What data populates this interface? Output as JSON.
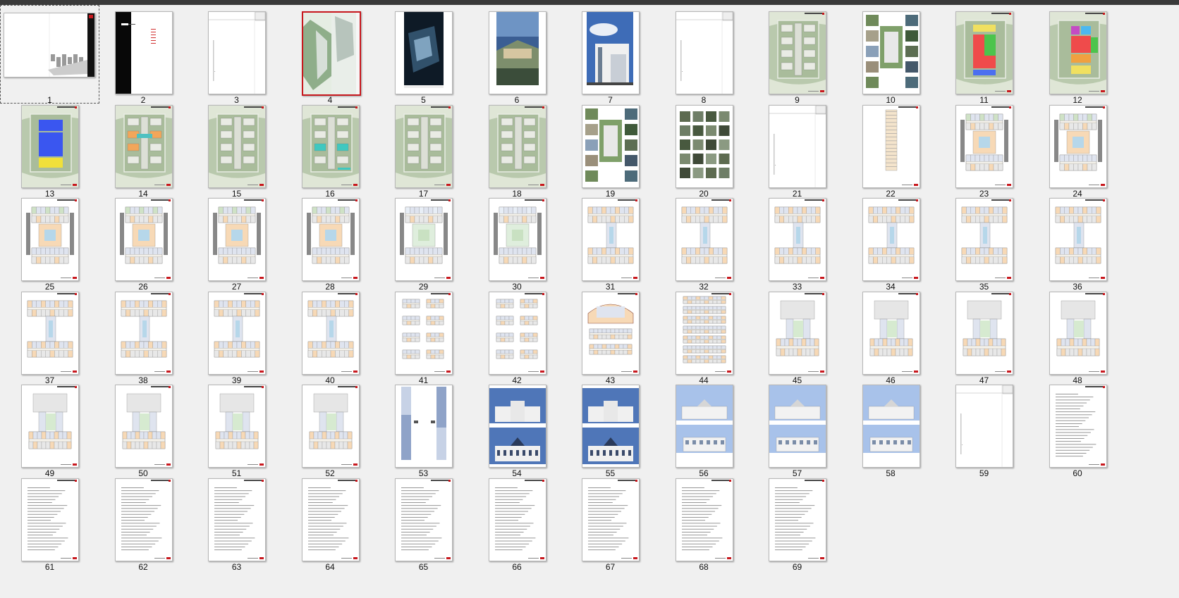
{
  "viewer": {
    "selected_page": "1",
    "highlighted_page": "4"
  },
  "pages": [
    {
      "label": "1",
      "kind": "cover"
    },
    {
      "label": "2",
      "kind": "black-index"
    },
    {
      "label": "3",
      "kind": "divider"
    },
    {
      "label": "4",
      "kind": "aerial-strip"
    },
    {
      "label": "5",
      "kind": "dark-render"
    },
    {
      "label": "6",
      "kind": "blue-render"
    },
    {
      "label": "7",
      "kind": "sky-render"
    },
    {
      "label": "8",
      "kind": "divider"
    },
    {
      "label": "9",
      "kind": "site-plan"
    },
    {
      "label": "10",
      "kind": "photo-collage"
    },
    {
      "label": "11",
      "kind": "zoning-red"
    },
    {
      "label": "12",
      "kind": "zoning-color"
    },
    {
      "label": "13",
      "kind": "zoning-blue"
    },
    {
      "label": "14",
      "kind": "site-orange"
    },
    {
      "label": "15",
      "kind": "site-plan"
    },
    {
      "label": "16",
      "kind": "site-teal"
    },
    {
      "label": "17",
      "kind": "site-plan"
    },
    {
      "label": "18",
      "kind": "site-plan"
    },
    {
      "label": "19",
      "kind": "photo-collage"
    },
    {
      "label": "20",
      "kind": "photo-grid"
    },
    {
      "label": "21",
      "kind": "divider"
    },
    {
      "label": "22",
      "kind": "long-plan"
    },
    {
      "label": "23",
      "kind": "floor-plan"
    },
    {
      "label": "24",
      "kind": "floor-plan"
    },
    {
      "label": "25",
      "kind": "floor-plan"
    },
    {
      "label": "26",
      "kind": "floor-plan"
    },
    {
      "label": "27",
      "kind": "floor-plan"
    },
    {
      "label": "28",
      "kind": "floor-plan"
    },
    {
      "label": "29",
      "kind": "floor-plan-light"
    },
    {
      "label": "30",
      "kind": "floor-plan-light"
    },
    {
      "label": "31",
      "kind": "h-plan"
    },
    {
      "label": "32",
      "kind": "h-plan"
    },
    {
      "label": "33",
      "kind": "h-plan"
    },
    {
      "label": "34",
      "kind": "h-plan"
    },
    {
      "label": "35",
      "kind": "h-plan"
    },
    {
      "label": "36",
      "kind": "h-plan"
    },
    {
      "label": "37",
      "kind": "h-plan"
    },
    {
      "label": "38",
      "kind": "h-plan"
    },
    {
      "label": "39",
      "kind": "h-plan"
    },
    {
      "label": "40",
      "kind": "h-plan"
    },
    {
      "label": "41",
      "kind": "small-plans"
    },
    {
      "label": "42",
      "kind": "small-plans"
    },
    {
      "label": "43",
      "kind": "arch-plan"
    },
    {
      "label": "44",
      "kind": "stack-plan"
    },
    {
      "label": "45",
      "kind": "u-plan"
    },
    {
      "label": "46",
      "kind": "u-plan"
    },
    {
      "label": "47",
      "kind": "u-plan"
    },
    {
      "label": "48",
      "kind": "u-plan"
    },
    {
      "label": "49",
      "kind": "u-plan"
    },
    {
      "label": "50",
      "kind": "u-plan"
    },
    {
      "label": "51",
      "kind": "u-plan"
    },
    {
      "label": "52",
      "kind": "u-plan"
    },
    {
      "label": "53",
      "kind": "section-blue"
    },
    {
      "label": "54",
      "kind": "elevation"
    },
    {
      "label": "55",
      "kind": "elevation"
    },
    {
      "label": "56",
      "kind": "elevation-sky"
    },
    {
      "label": "57",
      "kind": "elevation-sky"
    },
    {
      "label": "58",
      "kind": "elevation-sky"
    },
    {
      "label": "59",
      "kind": "divider"
    },
    {
      "label": "60",
      "kind": "text"
    },
    {
      "label": "61",
      "kind": "text"
    },
    {
      "label": "62",
      "kind": "text"
    },
    {
      "label": "63",
      "kind": "text"
    },
    {
      "label": "64",
      "kind": "text"
    },
    {
      "label": "65",
      "kind": "text"
    },
    {
      "label": "66",
      "kind": "text"
    },
    {
      "label": "67",
      "kind": "text"
    },
    {
      "label": "68",
      "kind": "text"
    },
    {
      "label": "69",
      "kind": "text"
    }
  ]
}
